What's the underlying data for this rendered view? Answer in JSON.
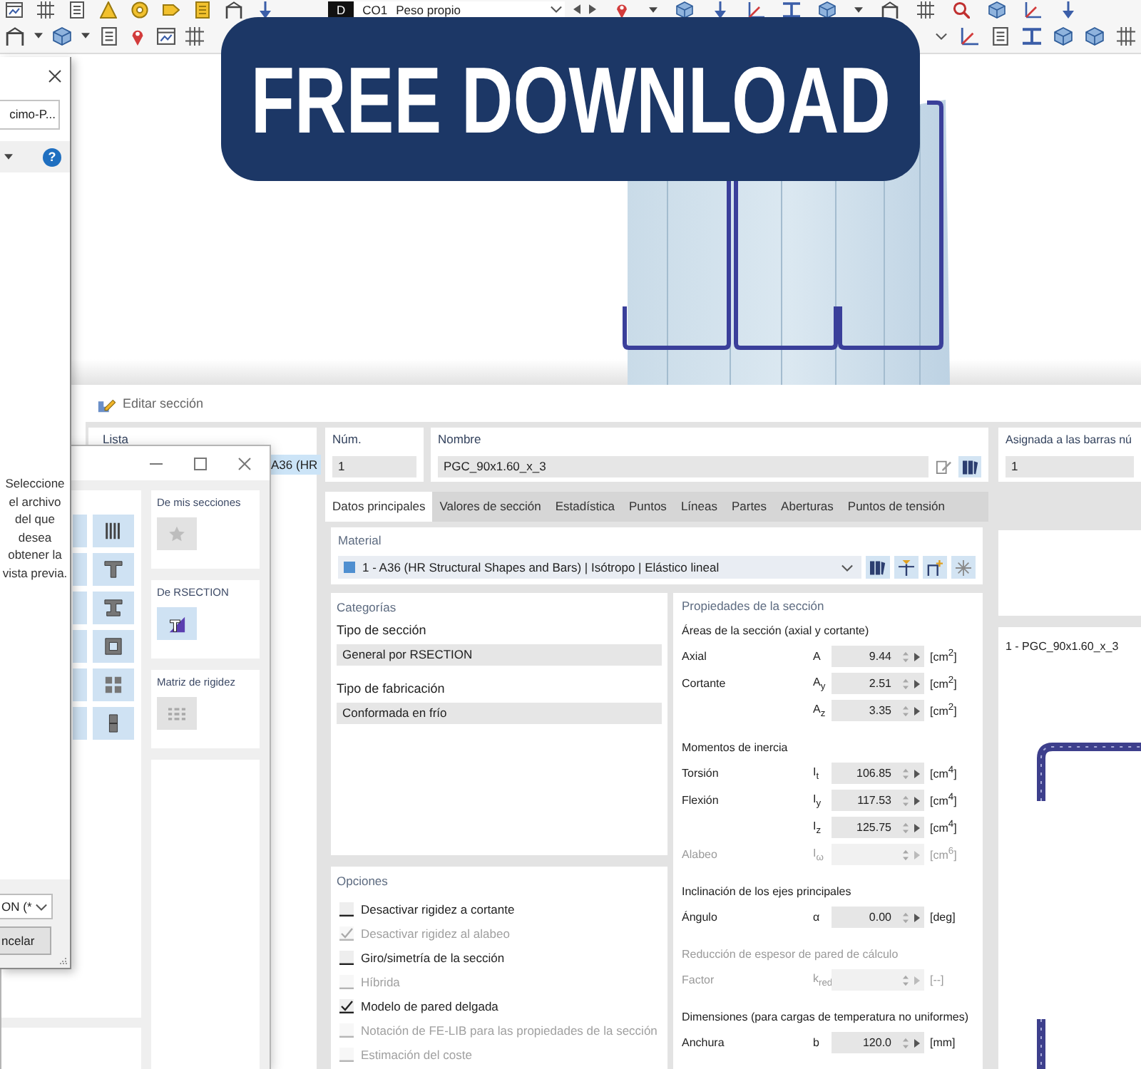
{
  "toolbar": {
    "load_case": {
      "badge": "D",
      "code": "CO1",
      "name": "Peso propio"
    }
  },
  "banner": {
    "text": "FREE DOWNLOAD"
  },
  "file_dialog": {
    "path_field": "cimo-P...",
    "help_button": "?",
    "hint": "Seleccione el archivo del que desea obtener la vista previa.",
    "file_type": "ON (*",
    "cancel_button": "ncelar"
  },
  "library_dialog": {
    "sources": [
      {
        "title": "De mis secciones",
        "kind": "favorites",
        "disabled": true
      },
      {
        "title": "De RSECTION",
        "kind": "rsection",
        "disabled": false
      },
      {
        "title": "Matriz de rigidez",
        "kind": "matrix",
        "disabled": true
      }
    ]
  },
  "edit_dialog": {
    "title": "Editar sección",
    "list": {
      "label": "Lista",
      "items": [
        {
          "text": "A36 (HR",
          "selected": true
        }
      ]
    },
    "number": {
      "label": "Núm.",
      "value": "1"
    },
    "name": {
      "label": "Nombre",
      "value": "PGC_90x1.60_x_3"
    },
    "assigned": {
      "label": "Asignada a las barras nú",
      "value": "1"
    },
    "tabs": [
      {
        "label": "Datos principales",
        "selected": true
      },
      {
        "label": "Valores de sección",
        "selected": false
      },
      {
        "label": "Estadística",
        "selected": false
      },
      {
        "label": "Puntos",
        "selected": false
      },
      {
        "label": "Líneas",
        "selected": false
      },
      {
        "label": "Partes",
        "selected": false
      },
      {
        "label": "Aberturas",
        "selected": false
      },
      {
        "label": "Puntos de tensión",
        "selected": false
      }
    ],
    "material": {
      "label": "Material",
      "value": "1 - A36 (HR Structural Shapes and Bars) | Isótropo | Elástico lineal"
    },
    "categories": {
      "title": "Categorías",
      "fields": [
        {
          "label": "Tipo de sección",
          "value": "General por RSECTION"
        },
        {
          "label": "Tipo de fabricación",
          "value": "Conformada en frío"
        }
      ]
    },
    "options": {
      "title": "Opciones",
      "items": [
        {
          "label": "Desactivar rigidez a cortante",
          "checked": false,
          "disabled": false
        },
        {
          "label": "Desactivar rigidez al alabeo",
          "checked": true,
          "disabled": true
        },
        {
          "label": "Giro/simetría de la sección",
          "checked": false,
          "disabled": false
        },
        {
          "label": "Híbrida",
          "checked": false,
          "disabled": true
        },
        {
          "label": "Modelo de pared delgada",
          "checked": true,
          "disabled": false
        },
        {
          "label": "Notación de FE-LIB para las propiedades de la sección",
          "checked": false,
          "disabled": true
        },
        {
          "label": "Estimación del coste",
          "checked": false,
          "disabled": true
        }
      ]
    },
    "properties": {
      "title": "Propiedades de la sección",
      "groups": [
        {
          "header": "Áreas de la sección (axial y cortante)",
          "disabled": false,
          "rows": [
            {
              "label": "Axial",
              "symbol": "A",
              "value": "9.44",
              "unit": "[cm$^{2}$]",
              "disabled": false
            },
            {
              "label": "Cortante",
              "symbol": "A$_{y}$",
              "value": "2.51",
              "unit": "[cm$^{2}$]",
              "disabled": false
            },
            {
              "symbol": "A$_{z}$",
              "value": "3.35",
              "unit": "[cm$^{2}$]",
              "disabled": false
            }
          ]
        },
        {
          "header": "Momentos de inercia",
          "disabled": false,
          "rows": [
            {
              "label": "Torsión",
              "symbol": "I$_{t}$",
              "value": "106.85",
              "unit": "[cm$^{4}$]",
              "disabled": false
            },
            {
              "label": "Flexión",
              "symbol": "I$_{y}$",
              "value": "117.53",
              "unit": "[cm$^{4}$]",
              "disabled": false
            },
            {
              "symbol": "I$_{z}$",
              "value": "125.75",
              "unit": "[cm$^{4}$]",
              "disabled": false
            },
            {
              "label": "Alabeo",
              "symbol": "I$_{ω}$",
              "unit": "[cm$^{6}$]",
              "disabled": true
            }
          ]
        },
        {
          "header": "Inclinación de los ejes principales",
          "disabled": false,
          "rows": [
            {
              "label": "Ángulo",
              "symbol": "α",
              "value": "0.00",
              "unit": "[deg]",
              "disabled": false
            }
          ]
        },
        {
          "header": "Reducción de espesor de pared de cálculo",
          "disabled": true,
          "rows": [
            {
              "label": "Factor",
              "symbol": "k$_{red}$",
              "unit": "[--]",
              "disabled": true
            }
          ]
        },
        {
          "header": "Dimensiones (para cargas de temperatura no uniformes)",
          "disabled": false,
          "rows": [
            {
              "label": "Anchura",
              "symbol": "b",
              "value": "120.0",
              "unit": "[mm]",
              "disabled": false
            }
          ]
        }
      ]
    },
    "preview": {
      "caption": "1 - PGC_90x1.60_x_3"
    }
  }
}
